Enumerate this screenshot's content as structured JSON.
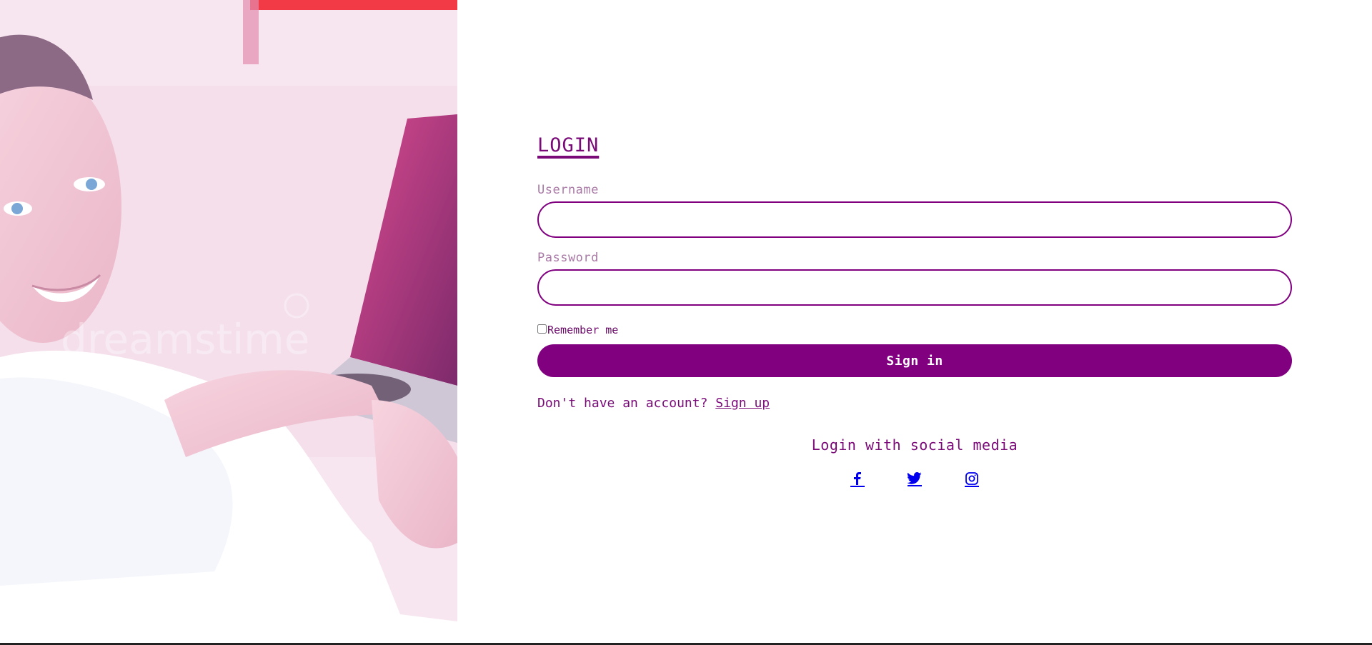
{
  "hero": {
    "image": "smiling-man-with-laptop-photo",
    "watermark": "dreamstime"
  },
  "login": {
    "title": "LOGIN",
    "username_label": "Username",
    "username_value": "",
    "password_label": "Password",
    "password_value": "",
    "remember_label": "Remember me",
    "remember_checked": false,
    "signin_label": "Sign in",
    "signup_prompt": "Don't have an account?",
    "signup_link": "Sign up"
  },
  "social": {
    "title": "Login with social media",
    "icons": [
      "facebook-icon",
      "twitter-icon",
      "instagram-icon"
    ]
  },
  "colors": {
    "accent": "#800080",
    "label": "#a97aa6",
    "link": "#0000ee"
  }
}
